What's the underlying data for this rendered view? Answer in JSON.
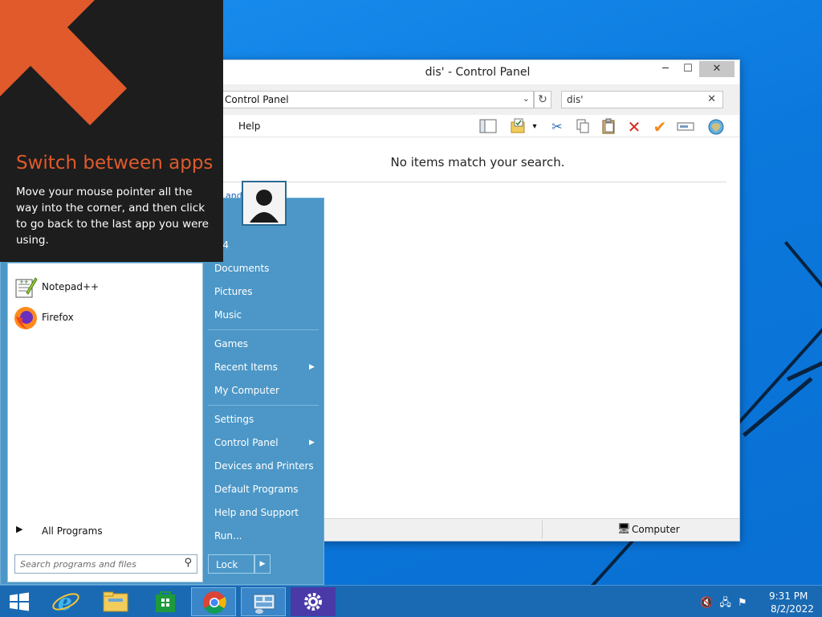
{
  "window": {
    "title": "dis' - Control Panel",
    "min_glyph": "─",
    "max_glyph": "☐",
    "close_glyph": "✕",
    "address": "Control Panel",
    "search_value": "dis'",
    "menu_help": "Help",
    "no_items_text": "No items match your search.",
    "search_again_text": "and        or \"dis'\"",
    "status_computer": "Computer"
  },
  "tip": {
    "title": "Switch between apps",
    "body": "Move your mouse pointer all the way into the corner, and then click to go back to the last app you were using."
  },
  "start_menu": {
    "programs": [
      {
        "label": "Notepad++",
        "icon": "notepad-plus-plus-icon"
      },
      {
        "label": "Firefox",
        "icon": "firefox-icon"
      }
    ],
    "all_programs": "All Programs",
    "search_placeholder": "Search programs and files",
    "right_items": [
      {
        "label": "M4"
      },
      {
        "label": "Documents"
      },
      {
        "label": "Pictures"
      },
      {
        "label": "Music"
      },
      {
        "label": "Games"
      },
      {
        "label": "Recent Items",
        "has_submenu": true
      },
      {
        "label": "My Computer"
      },
      {
        "label": "Settings"
      },
      {
        "label": "Control Panel",
        "has_submenu": true
      },
      {
        "label": "Devices and Printers"
      },
      {
        "label": "Default Programs"
      },
      {
        "label": "Help and Support"
      },
      {
        "label": "Run..."
      }
    ],
    "lock_label": "Lock"
  },
  "taskbar": {
    "apps": [
      "start-icon",
      "internet-explorer-icon",
      "file-explorer-icon",
      "store-icon",
      "chrome-icon",
      "control-panel-icon",
      "settings-icon"
    ],
    "time": "9:31 PM",
    "date": "8/2/2022"
  },
  "colors": {
    "tip_title": "#e05a2c",
    "start_menu_bg": "#4c97c7",
    "taskbar_bg": "#1a6ab3"
  }
}
